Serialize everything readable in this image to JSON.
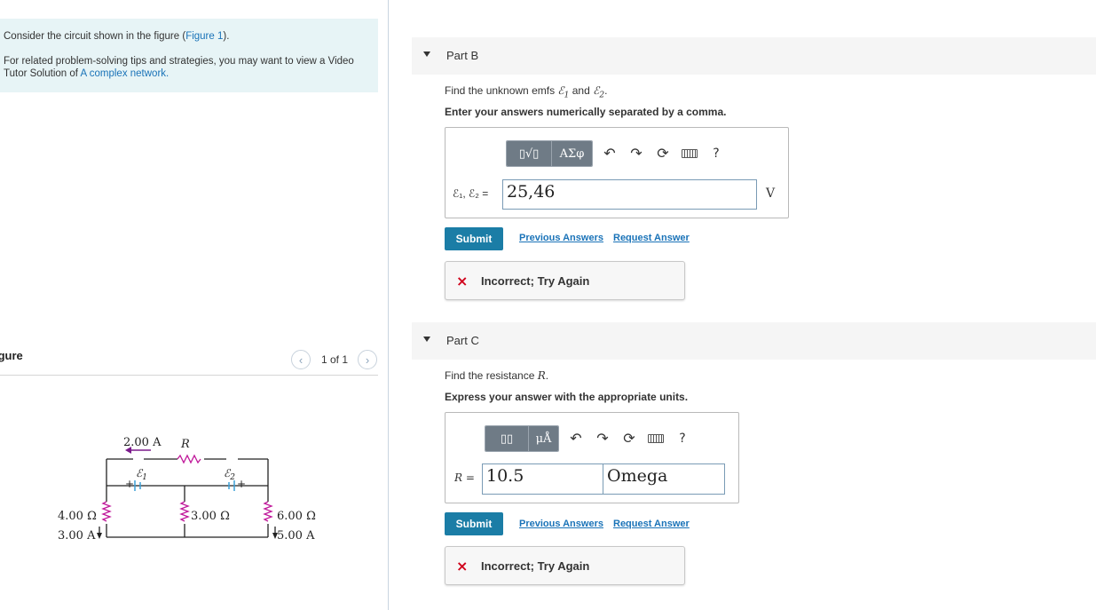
{
  "intro": {
    "line1_pre": "Consider the circuit shown in the figure (",
    "line1_link": "Figure 1",
    "line1_post": ").",
    "line2_pre": "For related problem-solving tips and strategies, you may want to view a Video Tutor Solution of ",
    "line2_link": "A complex network."
  },
  "figure": {
    "title": "igure",
    "pager": "1 of 1",
    "prev_icon": "chevron-left-icon",
    "next_icon": "chevron-right-icon",
    "labels": {
      "top_current": "2.00 A",
      "r_label": "R",
      "emf1": "ℰ",
      "emf1_sub": "1",
      "emf2": "ℰ",
      "emf2_sub": "2",
      "plus": "+",
      "left_res": "4.00 Ω",
      "left_cur": "3.00 A",
      "mid_res": "3.00 Ω",
      "right_res": "6.00 Ω",
      "right_cur": "5.00 A"
    }
  },
  "partB": {
    "title": "Part B",
    "question_pre": "Find the unknown emfs ",
    "question_mid": " and ",
    "question_post": ".",
    "emf_symbol": "ℰ",
    "sub1": "1",
    "sub2": "2",
    "instruction": "Enter your answers numerically separated by a comma.",
    "toolbar": {
      "templates": "▯√▯",
      "greek": "ΑΣφ",
      "help": "?"
    },
    "input_label": "ℰ₁, ℰ₂ =",
    "input_value": "25,46",
    "unit": "V",
    "submit": "Submit",
    "previous": "Previous Answers",
    "request": "Request Answer",
    "feedback_icon": "×",
    "feedback": "Incorrect; Try Again"
  },
  "partC": {
    "title": "Part C",
    "question_pre": "Find the resistance ",
    "question_var": "R",
    "question_post": ".",
    "instruction": "Express your answer with the appropriate units.",
    "toolbar": {
      "templates": "▯▯",
      "units": "μÅ",
      "help": "?"
    },
    "input_label": "R =",
    "value": "10.5",
    "unit_value": "Omega",
    "submit": "Submit",
    "previous": "Previous Answers",
    "request": "Request Answer",
    "feedback_icon": "×",
    "feedback": "Incorrect; Try Again"
  },
  "colors": {
    "intro_bg": "#e7f4f6",
    "link": "#1a73b8",
    "submit": "#1b7da6",
    "error": "#d0021b",
    "resistor": "#c0189a",
    "arrow": "#7b1a8c",
    "battery": "#3aa0d8"
  }
}
